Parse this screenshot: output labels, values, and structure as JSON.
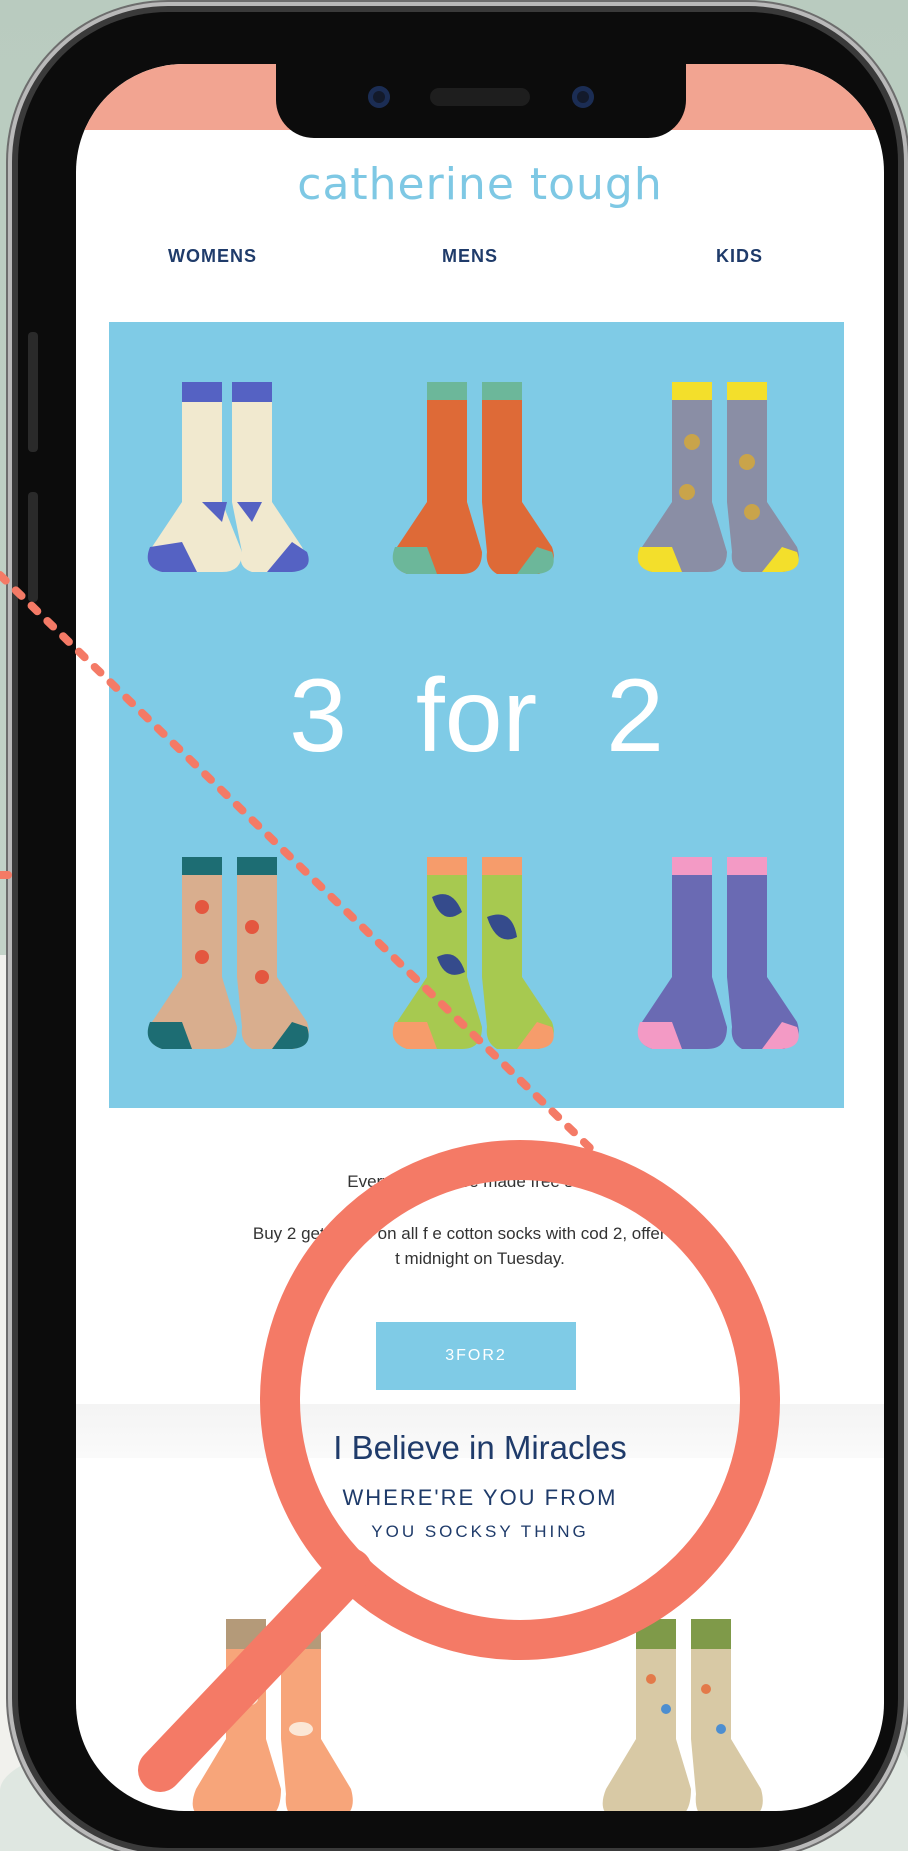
{
  "brand": {
    "logo_text": "catherine tough"
  },
  "nav": {
    "items": [
      "WOMENS",
      "MENS",
      "KIDS"
    ]
  },
  "hero": {
    "headline": "3 for 2"
  },
  "body": {
    "line1": "Every day can be made         free socks.",
    "line2": "Buy 2 get 1 free on all f         e cotton socks with cod           2, offer ends",
    "line3": "t midnight on Tuesday."
  },
  "cta": {
    "label": "3FOR2"
  },
  "section": {
    "title": "I Believe in Miracles",
    "subtitle": "WHERE'RE YOU FROM",
    "tagline": "YOU SOCKSY THING"
  },
  "colors": {
    "accent_blue": "#7fcbe6",
    "navy": "#1f3b6a",
    "coral": "#f47a66",
    "header_band": "#f2a491"
  },
  "icons": [
    "magnifier-icon"
  ]
}
